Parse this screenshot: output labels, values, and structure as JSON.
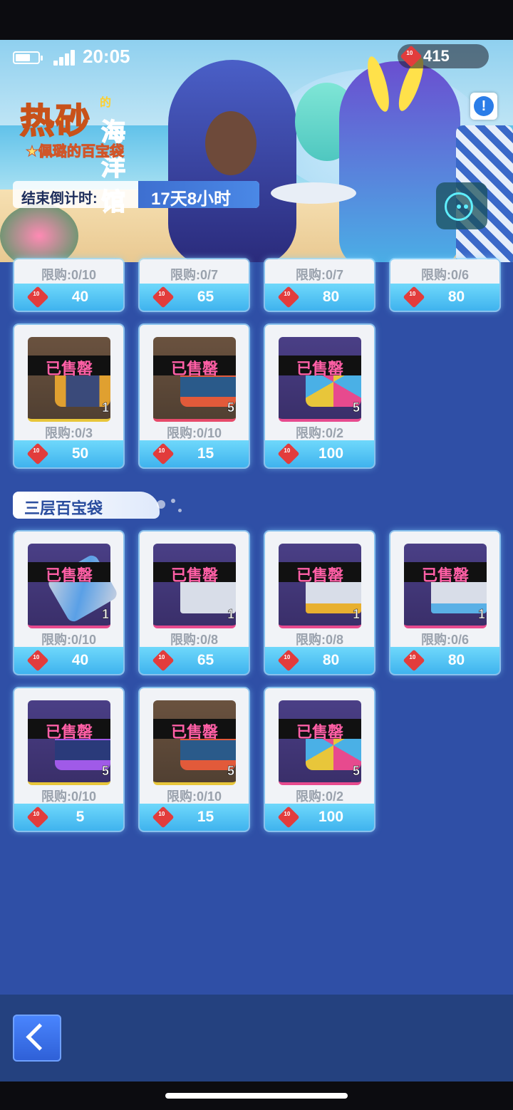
{
  "status_bar": {
    "time": "20:05"
  },
  "currency": {
    "icon": "ticket-icon",
    "value": "415"
  },
  "banner": {
    "title_main": "热砂",
    "title_small": "的",
    "title_side": "海洋馆",
    "subtitle": "★佩璐的百宝袋",
    "countdown_label": "结束倒计时:",
    "countdown_value": "17天8小时"
  },
  "sold_label": "已售罄",
  "top_partial_row": [
    {
      "limit": "限购:0/10",
      "price": "40"
    },
    {
      "limit": "限购:0/7",
      "price": "65"
    },
    {
      "limit": "限购:0/7",
      "price": "80"
    },
    {
      "limit": "限购:0/6",
      "price": "80"
    }
  ],
  "tier2_row2": [
    {
      "item": "kart-icon",
      "qty": "1",
      "limit": "限购:0/3",
      "price": "50"
    },
    {
      "item": "lantern-icon",
      "qty": "5",
      "limit": "限购:0/10",
      "price": "15"
    },
    {
      "item": "crystal-icon",
      "qty": "5",
      "limit": "限购:0/2",
      "price": "100"
    }
  ],
  "section3": {
    "title": "三层百宝袋",
    "row1": [
      {
        "item": "canister-icon",
        "qty": "1",
        "limit": "限购:0/10",
        "price": "40"
      },
      {
        "item": "nameplate-icon",
        "qty": "1",
        "limit": "限购:0/8",
        "price": "65"
      },
      {
        "item": "nameplate-icon",
        "qty": "1",
        "limit": "限购:0/8",
        "price": "80"
      },
      {
        "item": "nameplate-icon",
        "qty": "1",
        "limit": "限购:0/6",
        "price": "80"
      }
    ],
    "row2": [
      {
        "item": "lantern-purple-icon",
        "qty": "5",
        "limit": "限购:0/10",
        "price": "5"
      },
      {
        "item": "lantern-icon",
        "qty": "5",
        "limit": "限购:0/10",
        "price": "15"
      },
      {
        "item": "crystal-icon",
        "qty": "5",
        "limit": "限购:0/2",
        "price": "100"
      }
    ]
  },
  "colors": {
    "background": "#2f4fa6",
    "price_bar": "#4fc3f3",
    "sold_text": "#ff5fa6"
  }
}
